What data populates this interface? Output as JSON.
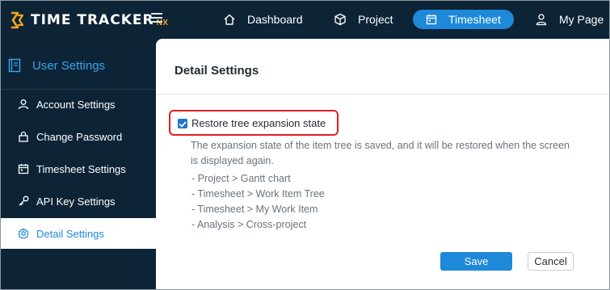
{
  "app": {
    "logo_text": "TIME TRACKER",
    "logo_suffix": "NX"
  },
  "nav": {
    "dashboard": "Dashboard",
    "project": "Project",
    "timesheet": "Timesheet",
    "mypage": "My Page",
    "active": "timesheet"
  },
  "sidebar": {
    "title": "User Settings",
    "items": [
      {
        "label": "Account Settings",
        "icon": "person-icon"
      },
      {
        "label": "Change Password",
        "icon": "lock-icon"
      },
      {
        "label": "Timesheet Settings",
        "icon": "calendar-icon"
      },
      {
        "label": "API Key Settings",
        "icon": "key-icon"
      },
      {
        "label": "Detail Settings",
        "icon": "gear-icon"
      }
    ],
    "active_index": 4
  },
  "main": {
    "title": "Detail Settings",
    "option": {
      "label": "Restore tree expansion state",
      "checked": true
    },
    "description": "The expansion state of the item tree is saved, and it will be restored when the screen is displayed again.",
    "paths": [
      "- Project > Gantt chart",
      "- Timesheet > Work Item Tree",
      "- Timesheet > My Work Item",
      "- Analysis > Cross-project"
    ],
    "save_label": "Save",
    "cancel_label": "Cancel"
  },
  "colors": {
    "nav_bg": "#0d2436",
    "accent": "#1e88d9",
    "highlight": "#e02020",
    "logo_accent": "#f5a623"
  }
}
